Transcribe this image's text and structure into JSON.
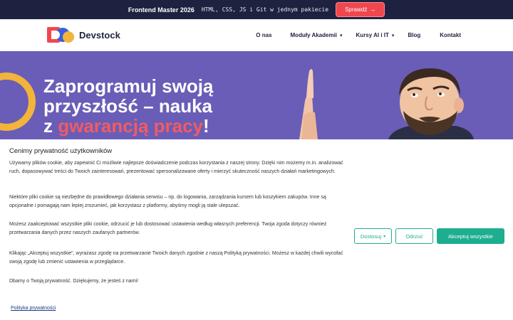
{
  "promo": {
    "title": "Frontend Master 2026",
    "text": "HTML, CSS, JS i Git w jednym pakiecie",
    "button_label": "Sprawdź",
    "button_arrow": "→"
  },
  "nav": {
    "logo_text": "Devstock",
    "items": [
      {
        "label": "O nas",
        "has_dropdown": false
      },
      {
        "label": "Moduły Akademii",
        "has_dropdown": true
      },
      {
        "label": "Kursy AI i IT",
        "has_dropdown": true
      },
      {
        "label": "Blog",
        "has_dropdown": false
      },
      {
        "label": "Kontakt",
        "has_dropdown": false
      }
    ]
  },
  "hero": {
    "line1": "Zaprogramuj swoją",
    "line2": "przyszłość – nauka",
    "line3_prefix": "z ",
    "line3_accent": "gwarancją pracy",
    "line3_suffix": "!"
  },
  "cookie": {
    "title": "Cenimy prywatność użytkowników",
    "paragraphs": [
      "Używamy plików cookie, aby zapewnić Ci możliwie najlepsze doświadczenie podczas korzystania z naszej strony. Dzięki nim możemy m.in. analizować ruch, dopasowywać treści do Twoich zainteresowań, prezentować spersonalizowane oferty i mierzyć skuteczność naszych działań marketingowych.",
      "Niektóre pliki cookie są niezbędne do prawidłowego działania serwisu – np. do logowania, zarządzania kursem lub koszykiem zakupów. Inne są opcjonalne i pomagają nam lepiej zrozumieć, jak korzystasz z platformy, abyśmy mogli ją stale ulepszać.",
      "Możesz zaakceptować wszystkie pliki cookie, odrzucić je lub dostosować ustawienia według własnych preferencji. Twoja zgoda dotyczy również przetwarzania danych przez naszych zaufanych partnerów.",
      "Klikając „Akceptuj wszystkie\", wyrażasz zgodę na przetwarzanie Twoich danych zgodnie z naszą Polityką prywatności. Możesz w każdej chwili wycofać swoją zgodę lub zmienić ustawienia w przeglądarce.",
      "Dbamy o Twoją prywatność. Dziękujemy, że jesteś z nami!"
    ],
    "policy_link": "Polityka prywatności",
    "buttons": {
      "customize": "Dostosuj",
      "reject": "Odrzuć",
      "accept_all": "Akceptuj wszystkie"
    }
  },
  "colors": {
    "navy": "#1e2240",
    "coral": "#f0474f",
    "hero_purple": "#6a5db7",
    "teal": "#1dae8f",
    "ring_yellow": "#f2b43a"
  }
}
